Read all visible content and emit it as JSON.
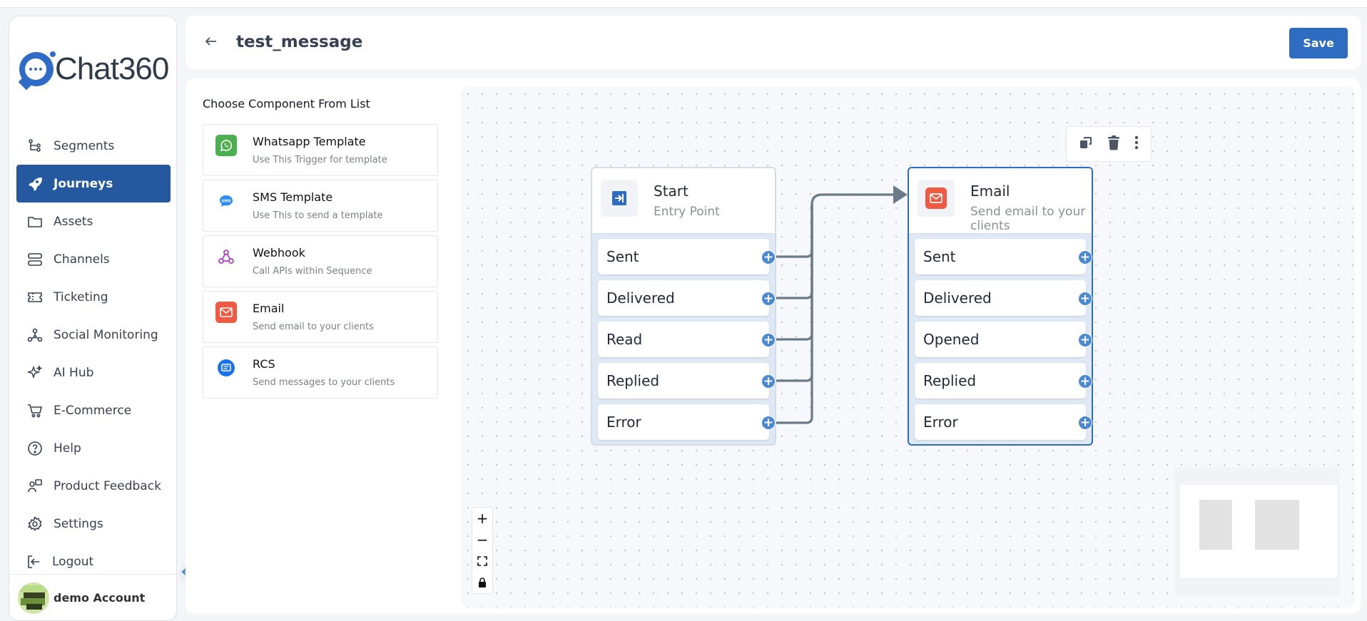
{
  "brand": {
    "name": "Chat360"
  },
  "sidebar": {
    "items": [
      {
        "label": "Segments",
        "icon": "segments-icon",
        "active": false
      },
      {
        "label": "Journeys",
        "icon": "rocket-icon",
        "active": true
      },
      {
        "label": "Assets",
        "icon": "folder-icon",
        "active": false
      },
      {
        "label": "Channels",
        "icon": "channels-icon",
        "active": false
      },
      {
        "label": "Ticketing",
        "icon": "ticket-icon",
        "active": false
      },
      {
        "label": "Social Monitoring",
        "icon": "network-icon",
        "active": false
      },
      {
        "label": "AI Hub",
        "icon": "sparkle-icon",
        "active": false
      },
      {
        "label": "E-Commerce",
        "icon": "cart-icon",
        "active": false
      },
      {
        "label": "Help",
        "icon": "help-icon",
        "active": false
      },
      {
        "label": "Product Feedback",
        "icon": "feedback-icon",
        "active": false
      },
      {
        "label": "Settings",
        "icon": "gear-icon",
        "active": false
      },
      {
        "label": "Logout",
        "icon": "logout-icon",
        "active": false
      }
    ],
    "account": "demo Account"
  },
  "header": {
    "title": "test_message",
    "save_label": "Save"
  },
  "components": {
    "title": "Choose Component From List",
    "items": [
      {
        "name": "Whatsapp Template",
        "desc": "Use This Trigger for template",
        "icon": "whatsapp-icon"
      },
      {
        "name": "SMS Template",
        "desc": "Use This to send a template",
        "icon": "sms-icon"
      },
      {
        "name": "Webhook",
        "desc": "Call APIs within Sequence",
        "icon": "webhook-icon"
      },
      {
        "name": "Email",
        "desc": "Send email to your clients",
        "icon": "email-icon"
      },
      {
        "name": "RCS",
        "desc": "Send messages to your clients",
        "icon": "rcs-icon"
      }
    ]
  },
  "canvas": {
    "nodes": {
      "start": {
        "title": "Start",
        "sub": "Entry Point",
        "ports": [
          "Sent",
          "Delivered",
          "Read",
          "Replied",
          "Error"
        ]
      },
      "email": {
        "title": "Email",
        "sub": "Send email to your clients",
        "ports": [
          "Sent",
          "Delivered",
          "Opened",
          "Replied",
          "Error"
        ]
      }
    },
    "controls": {
      "zoom_in": "+",
      "zoom_out": "−"
    }
  },
  "colors": {
    "primary": "#2d6cc0",
    "active_nav": "#24589f",
    "email_red": "#f05a43",
    "whatsapp_green": "#4caf50"
  }
}
